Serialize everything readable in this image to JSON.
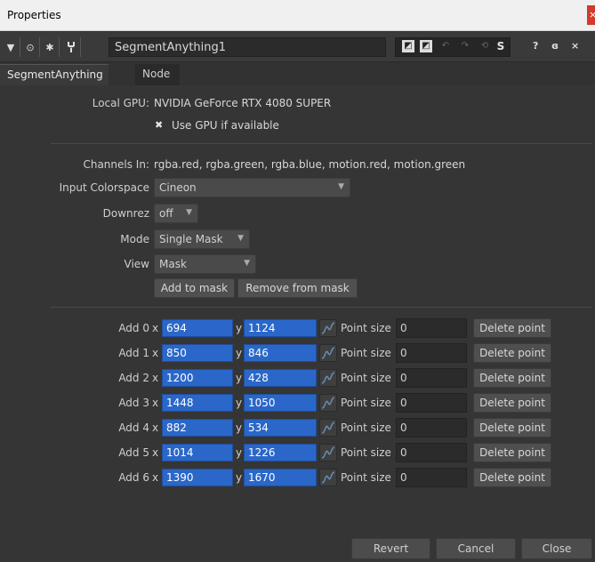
{
  "window": {
    "title": "Properties",
    "close_glyph": "×"
  },
  "toolbar": {
    "node_name": "SegmentAnything1",
    "s_label": "S",
    "help_glyph": "?",
    "float_glyph": "ɞ",
    "close_glyph": "×"
  },
  "tabs": [
    {
      "label": "SegmentAnything",
      "active": true
    },
    {
      "label": "Node",
      "active": false
    }
  ],
  "local_gpu": {
    "label": "Local GPU:",
    "value": "NVIDIA GeForce RTX 4080 SUPER"
  },
  "use_gpu": {
    "label": "Use GPU if available",
    "checked": true,
    "glyph": "✖"
  },
  "channels_in": {
    "label": "Channels In:",
    "value": "rgba.red, rgba.green, rgba.blue, motion.red, motion.green"
  },
  "input_colorspace": {
    "label": "Input Colorspace",
    "value": "Cineon"
  },
  "downrez": {
    "label": "Downrez",
    "value": "off"
  },
  "mode": {
    "label": "Mode",
    "value": "Single Mask"
  },
  "view": {
    "label": "View",
    "value": "Mask"
  },
  "buttons": {
    "add_to_mask": "Add to mask",
    "remove_from_mask": "Remove from mask"
  },
  "point_labels": {
    "x": "x",
    "y": "y",
    "point_size": "Point size",
    "delete": "Delete point"
  },
  "points": [
    {
      "label": "Add 0",
      "x": "694",
      "y": "1124",
      "size": "0"
    },
    {
      "label": "Add 1",
      "x": "850",
      "y": "846",
      "size": "0"
    },
    {
      "label": "Add 2",
      "x": "1200",
      "y": "428",
      "size": "0"
    },
    {
      "label": "Add 3",
      "x": "1448",
      "y": "1050",
      "size": "0"
    },
    {
      "label": "Add 4",
      "x": "882",
      "y": "534",
      "size": "0"
    },
    {
      "label": "Add 5",
      "x": "1014",
      "y": "1226",
      "size": "0"
    },
    {
      "label": "Add 6",
      "x": "1390",
      "y": "1670",
      "size": "0"
    }
  ],
  "footer": {
    "revert": "Revert",
    "cancel": "Cancel",
    "close": "Close"
  },
  "colors": {
    "field_blue": "#2a67c9",
    "close_red": "#d33a2c"
  }
}
